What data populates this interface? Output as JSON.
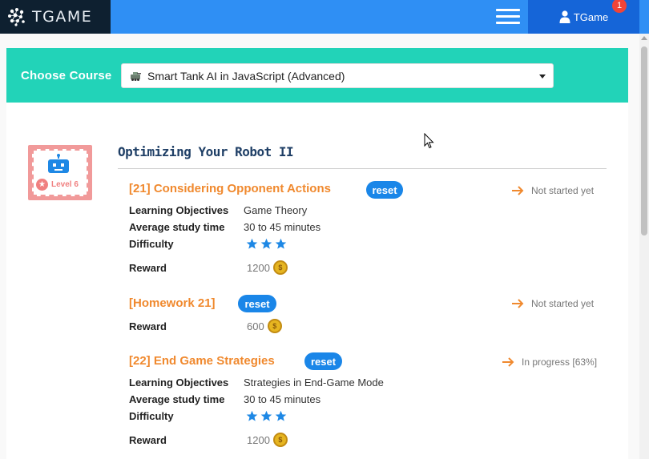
{
  "app": {
    "logo_text": "TGAME",
    "user_name": "TGame",
    "notification_count": "1"
  },
  "course": {
    "label": "Choose Course",
    "selected": "Smart Tank AI in JavaScript (Advanced)"
  },
  "level": {
    "label": "Level 6"
  },
  "section": {
    "title": "Optimizing Your Robot II"
  },
  "labels": {
    "objectives": "Learning Objectives",
    "study_time": "Average study time",
    "difficulty": "Difficulty",
    "reward": "Reward",
    "reset": "reset"
  },
  "lessons": [
    {
      "title": "[21] Considering Opponent Actions",
      "status": "Not started yet",
      "objectives": "Game Theory",
      "study_time": "30 to 45 minutes",
      "difficulty": 3,
      "reward": "1200"
    },
    {
      "title": "[Homework 21]",
      "status": "Not started yet",
      "reward": "600"
    },
    {
      "title": "[22] End Game Strategies",
      "status": "In progress [63%]",
      "objectives": "Strategies in End-Game Mode",
      "study_time": "30 to 45 minutes",
      "difficulty": 3,
      "reward": "1200"
    }
  ],
  "colors": {
    "topbar": "#2f8ff4",
    "course_bar": "#22d3b8",
    "lesson_title": "#f0892e",
    "reset_button": "#1a86e8",
    "star": "#1e88e5"
  },
  "icons": {
    "menu": "hamburger-icon",
    "user": "user-icon",
    "arrow": "arrow-right-icon",
    "coin": "coin-icon",
    "star": "star-icon"
  }
}
